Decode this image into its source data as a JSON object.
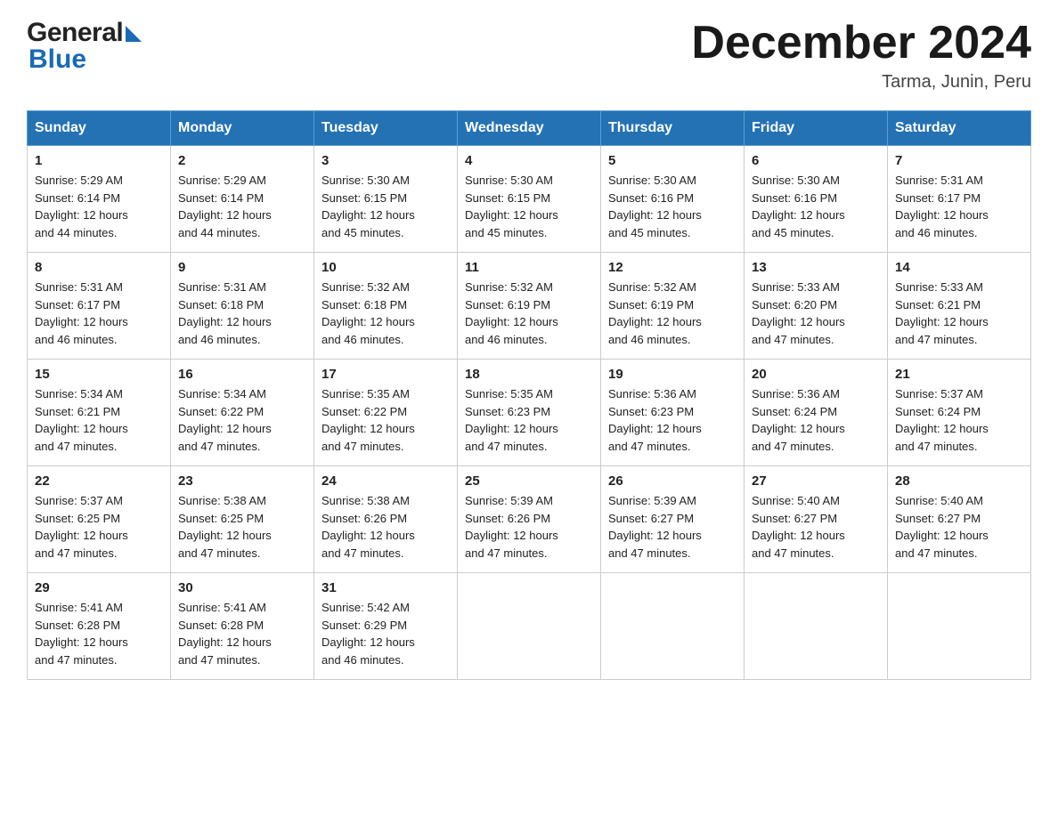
{
  "header": {
    "month_title": "December 2024",
    "location": "Tarma, Junin, Peru",
    "logo_general": "General",
    "logo_blue": "Blue"
  },
  "weekdays": [
    "Sunday",
    "Monday",
    "Tuesday",
    "Wednesday",
    "Thursday",
    "Friday",
    "Saturday"
  ],
  "weeks": [
    [
      {
        "day": "1",
        "sunrise": "5:29 AM",
        "sunset": "6:14 PM",
        "daylight": "12 hours and 44 minutes."
      },
      {
        "day": "2",
        "sunrise": "5:29 AM",
        "sunset": "6:14 PM",
        "daylight": "12 hours and 44 minutes."
      },
      {
        "day": "3",
        "sunrise": "5:30 AM",
        "sunset": "6:15 PM",
        "daylight": "12 hours and 45 minutes."
      },
      {
        "day": "4",
        "sunrise": "5:30 AM",
        "sunset": "6:15 PM",
        "daylight": "12 hours and 45 minutes."
      },
      {
        "day": "5",
        "sunrise": "5:30 AM",
        "sunset": "6:16 PM",
        "daylight": "12 hours and 45 minutes."
      },
      {
        "day": "6",
        "sunrise": "5:30 AM",
        "sunset": "6:16 PM",
        "daylight": "12 hours and 45 minutes."
      },
      {
        "day": "7",
        "sunrise": "5:31 AM",
        "sunset": "6:17 PM",
        "daylight": "12 hours and 46 minutes."
      }
    ],
    [
      {
        "day": "8",
        "sunrise": "5:31 AM",
        "sunset": "6:17 PM",
        "daylight": "12 hours and 46 minutes."
      },
      {
        "day": "9",
        "sunrise": "5:31 AM",
        "sunset": "6:18 PM",
        "daylight": "12 hours and 46 minutes."
      },
      {
        "day": "10",
        "sunrise": "5:32 AM",
        "sunset": "6:18 PM",
        "daylight": "12 hours and 46 minutes."
      },
      {
        "day": "11",
        "sunrise": "5:32 AM",
        "sunset": "6:19 PM",
        "daylight": "12 hours and 46 minutes."
      },
      {
        "day": "12",
        "sunrise": "5:32 AM",
        "sunset": "6:19 PM",
        "daylight": "12 hours and 46 minutes."
      },
      {
        "day": "13",
        "sunrise": "5:33 AM",
        "sunset": "6:20 PM",
        "daylight": "12 hours and 47 minutes."
      },
      {
        "day": "14",
        "sunrise": "5:33 AM",
        "sunset": "6:21 PM",
        "daylight": "12 hours and 47 minutes."
      }
    ],
    [
      {
        "day": "15",
        "sunrise": "5:34 AM",
        "sunset": "6:21 PM",
        "daylight": "12 hours and 47 minutes."
      },
      {
        "day": "16",
        "sunrise": "5:34 AM",
        "sunset": "6:22 PM",
        "daylight": "12 hours and 47 minutes."
      },
      {
        "day": "17",
        "sunrise": "5:35 AM",
        "sunset": "6:22 PM",
        "daylight": "12 hours and 47 minutes."
      },
      {
        "day": "18",
        "sunrise": "5:35 AM",
        "sunset": "6:23 PM",
        "daylight": "12 hours and 47 minutes."
      },
      {
        "day": "19",
        "sunrise": "5:36 AM",
        "sunset": "6:23 PM",
        "daylight": "12 hours and 47 minutes."
      },
      {
        "day": "20",
        "sunrise": "5:36 AM",
        "sunset": "6:24 PM",
        "daylight": "12 hours and 47 minutes."
      },
      {
        "day": "21",
        "sunrise": "5:37 AM",
        "sunset": "6:24 PM",
        "daylight": "12 hours and 47 minutes."
      }
    ],
    [
      {
        "day": "22",
        "sunrise": "5:37 AM",
        "sunset": "6:25 PM",
        "daylight": "12 hours and 47 minutes."
      },
      {
        "day": "23",
        "sunrise": "5:38 AM",
        "sunset": "6:25 PM",
        "daylight": "12 hours and 47 minutes."
      },
      {
        "day": "24",
        "sunrise": "5:38 AM",
        "sunset": "6:26 PM",
        "daylight": "12 hours and 47 minutes."
      },
      {
        "day": "25",
        "sunrise": "5:39 AM",
        "sunset": "6:26 PM",
        "daylight": "12 hours and 47 minutes."
      },
      {
        "day": "26",
        "sunrise": "5:39 AM",
        "sunset": "6:27 PM",
        "daylight": "12 hours and 47 minutes."
      },
      {
        "day": "27",
        "sunrise": "5:40 AM",
        "sunset": "6:27 PM",
        "daylight": "12 hours and 47 minutes."
      },
      {
        "day": "28",
        "sunrise": "5:40 AM",
        "sunset": "6:27 PM",
        "daylight": "12 hours and 47 minutes."
      }
    ],
    [
      {
        "day": "29",
        "sunrise": "5:41 AM",
        "sunset": "6:28 PM",
        "daylight": "12 hours and 47 minutes."
      },
      {
        "day": "30",
        "sunrise": "5:41 AM",
        "sunset": "6:28 PM",
        "daylight": "12 hours and 47 minutes."
      },
      {
        "day": "31",
        "sunrise": "5:42 AM",
        "sunset": "6:29 PM",
        "daylight": "12 hours and 46 minutes."
      },
      null,
      null,
      null,
      null
    ]
  ],
  "labels": {
    "sunrise": "Sunrise:",
    "sunset": "Sunset:",
    "daylight": "Daylight:"
  },
  "colors": {
    "header_bg": "#2472b3",
    "border": "#aaaaaa",
    "cell_border": "#cccccc"
  }
}
